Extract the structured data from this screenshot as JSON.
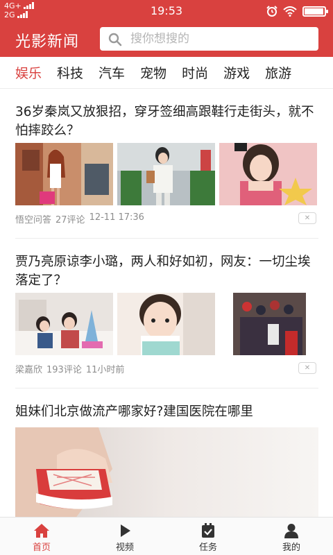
{
  "status": {
    "network_top": "4G+",
    "network_bottom": "2G",
    "time": "19:53",
    "battery_level": 0.95
  },
  "app": {
    "title": "光影新闻",
    "accent": "#d9413f"
  },
  "search": {
    "placeholder": "搜你想搜的"
  },
  "tabs": [
    {
      "label": "娱乐",
      "active": true
    },
    {
      "label": "科技"
    },
    {
      "label": "汽车"
    },
    {
      "label": "宠物"
    },
    {
      "label": "时尚"
    },
    {
      "label": "游戏"
    },
    {
      "label": "旅游"
    }
  ],
  "articles": [
    {
      "title": "36岁秦岚又放狠招，穿牙签细高跟鞋行走街头，就不怕摔跤么？",
      "source": "悟空问答",
      "comments": "27评论",
      "time": "12-11 17:36"
    },
    {
      "title": "贾乃亮原谅李小璐，两人和好如初，网友：一切尘埃落定了？",
      "source": "梁嘉欣",
      "comments": "193评论",
      "time": "11小时前"
    },
    {
      "title": "姐妹们北京做流产哪家好?建国医院在哪里"
    }
  ],
  "dislike_label": "✕",
  "bottom_nav": [
    {
      "label": "首页",
      "icon": "home-icon",
      "active": true
    },
    {
      "label": "视频",
      "icon": "play-icon"
    },
    {
      "label": "任务",
      "icon": "task-icon"
    },
    {
      "label": "我的",
      "icon": "user-icon"
    }
  ]
}
